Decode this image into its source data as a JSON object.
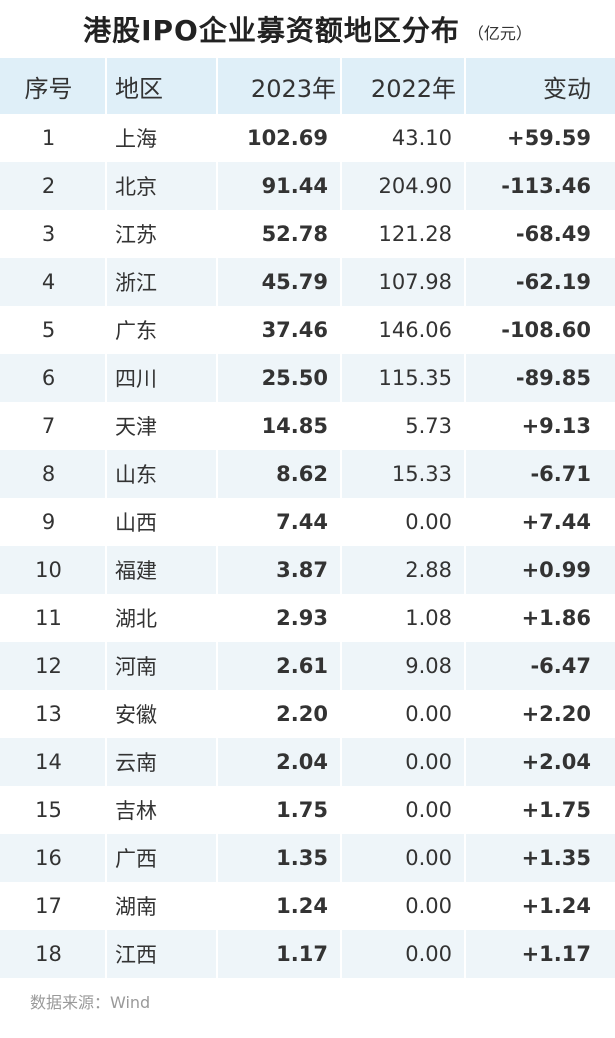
{
  "header": {
    "title": "港股IPO企业募资额地区分布",
    "unit": "（亿元）"
  },
  "table": {
    "columns": [
      "序号",
      "地区",
      "2023年",
      "2022年",
      "变动"
    ]
  },
  "chart_data": {
    "type": "table",
    "title": "港股IPO企业募资额地区分布",
    "unit": "（亿元）",
    "columns": [
      "序号",
      "地区",
      "2023年",
      "2022年",
      "变动"
    ],
    "rows": [
      {
        "idx": "1",
        "region": "上海",
        "y2023": "102.69",
        "y2022": "43.10",
        "change": "+59.59"
      },
      {
        "idx": "2",
        "region": "北京",
        "y2023": "91.44",
        "y2022": "204.90",
        "change": "-113.46"
      },
      {
        "idx": "3",
        "region": "江苏",
        "y2023": "52.78",
        "y2022": "121.28",
        "change": "-68.49"
      },
      {
        "idx": "4",
        "region": "浙江",
        "y2023": "45.79",
        "y2022": "107.98",
        "change": "-62.19"
      },
      {
        "idx": "5",
        "region": "广东",
        "y2023": "37.46",
        "y2022": "146.06",
        "change": "-108.60"
      },
      {
        "idx": "6",
        "region": "四川",
        "y2023": "25.50",
        "y2022": "115.35",
        "change": "-89.85"
      },
      {
        "idx": "7",
        "region": "天津",
        "y2023": "14.85",
        "y2022": "5.73",
        "change": "+9.13"
      },
      {
        "idx": "8",
        "region": "山东",
        "y2023": "8.62",
        "y2022": "15.33",
        "change": "-6.71"
      },
      {
        "idx": "9",
        "region": "山西",
        "y2023": "7.44",
        "y2022": "0.00",
        "change": "+7.44"
      },
      {
        "idx": "10",
        "region": "福建",
        "y2023": "3.87",
        "y2022": "2.88",
        "change": "+0.99"
      },
      {
        "idx": "11",
        "region": "湖北",
        "y2023": "2.93",
        "y2022": "1.08",
        "change": "+1.86"
      },
      {
        "idx": "12",
        "region": "河南",
        "y2023": "2.61",
        "y2022": "9.08",
        "change": "-6.47"
      },
      {
        "idx": "13",
        "region": "安徽",
        "y2023": "2.20",
        "y2022": "0.00",
        "change": "+2.20"
      },
      {
        "idx": "14",
        "region": "云南",
        "y2023": "2.04",
        "y2022": "0.00",
        "change": "+2.04"
      },
      {
        "idx": "15",
        "region": "吉林",
        "y2023": "1.75",
        "y2022": "0.00",
        "change": "+1.75"
      },
      {
        "idx": "16",
        "region": "广西",
        "y2023": "1.35",
        "y2022": "0.00",
        "change": "+1.35"
      },
      {
        "idx": "17",
        "region": "湖南",
        "y2023": "1.24",
        "y2022": "0.00",
        "change": "+1.24"
      },
      {
        "idx": "18",
        "region": "江西",
        "y2023": "1.17",
        "y2022": "0.00",
        "change": "+1.17"
      }
    ]
  },
  "footer": {
    "source": "数据来源：Wind"
  },
  "colors": {
    "header_bg": "#dfeff8",
    "stripe_bg": "#eef5f9",
    "positive": "#e8141b",
    "negative": "#10a048",
    "source_text": "#9a9a9a"
  }
}
